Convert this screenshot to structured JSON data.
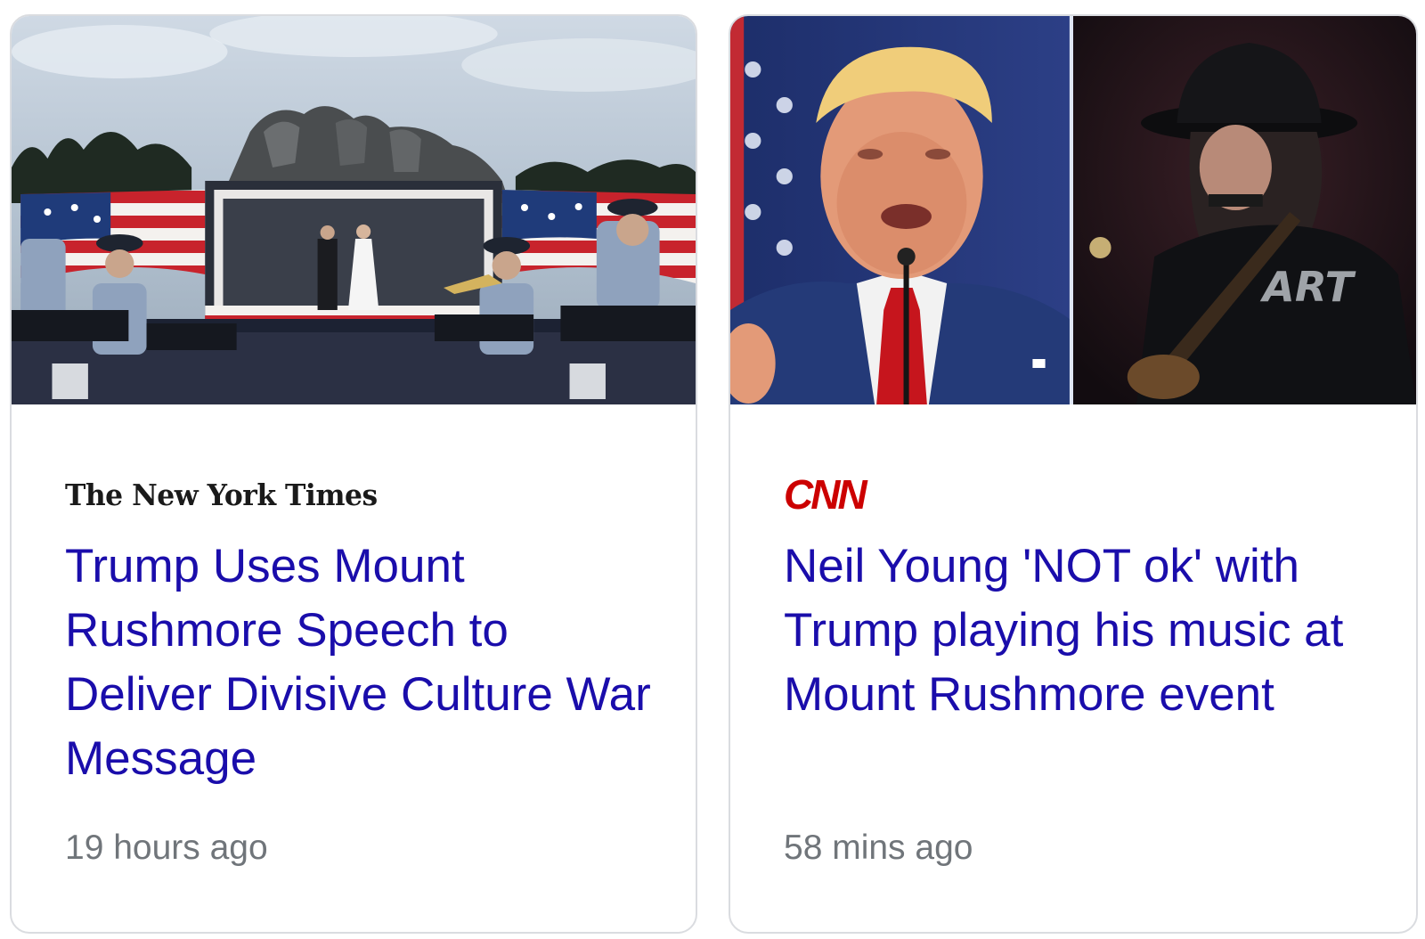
{
  "articles": [
    {
      "source": "The New York Times",
      "headline": "Trump Uses Mount Rushmore Speech to Deliver Divisive Culture War Message",
      "time": "19 hours ago",
      "image_desc": "mount-rushmore-stage-photo"
    },
    {
      "source": "CNN",
      "headline": "Neil Young 'NOT ok' with Trump playing his music at Mount Rushmore event",
      "time": "58 mins ago",
      "image_desc": "trump-and-neil-young-photo",
      "shirt_text": "ART"
    }
  ],
  "colors": {
    "headline": "#1a0dab",
    "time": "#70757a",
    "cnn_red": "#cc0000",
    "border": "#dadce0"
  }
}
